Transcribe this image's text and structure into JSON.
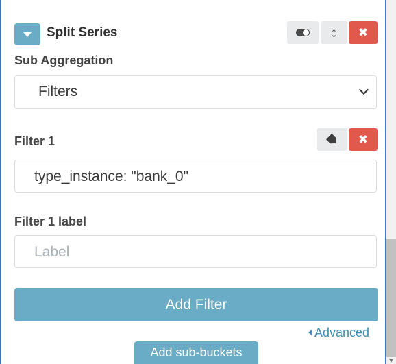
{
  "header": {
    "title": "Split Series",
    "toggle_icon": "toggle-icon",
    "reorder_icon": "vertical-arrows-icon",
    "remove_icon": "close-icon",
    "remove_glyph": "✖"
  },
  "sub_aggregation": {
    "label": "Sub Aggregation",
    "selected": "Filters"
  },
  "filter1": {
    "label": "Filter 1",
    "value": "type_instance: \"bank_0\"",
    "tag_icon": "tag-icon",
    "remove_glyph": "✖"
  },
  "filter1_label": {
    "label": "Filter 1 label",
    "placeholder": "Label",
    "value": ""
  },
  "actions": {
    "add_filter": "Add Filter",
    "advanced": "Advanced",
    "add_sub_buckets": "Add sub-buckets"
  },
  "colors": {
    "accent": "#6aacc5",
    "danger": "#e1584d",
    "link": "#3f8fb3",
    "border": "#3b73b9"
  }
}
